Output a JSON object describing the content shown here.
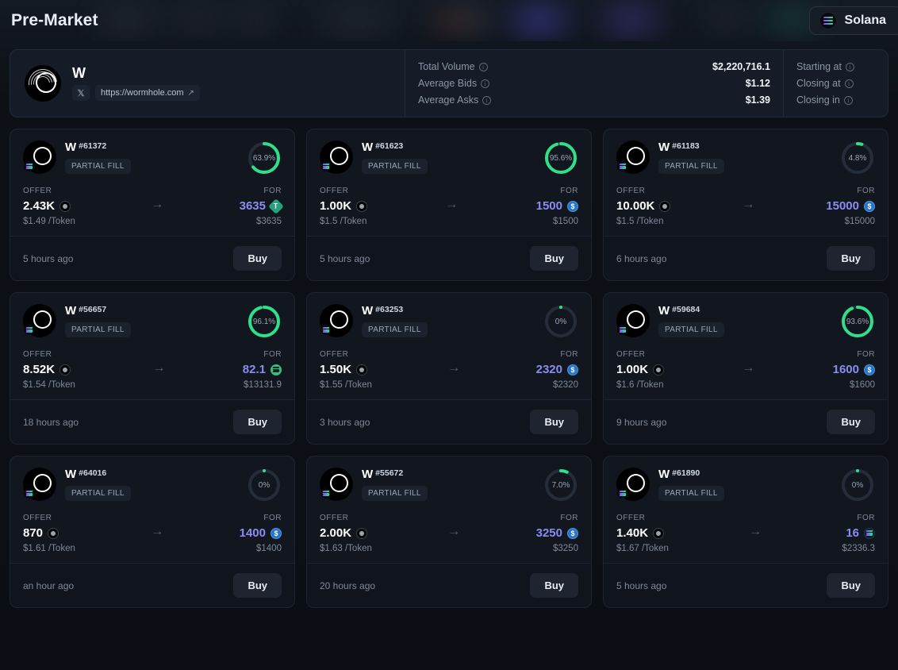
{
  "header": {
    "title": "Pre-Market",
    "chain_pill": {
      "label": "Solana",
      "icon": "solana-icon"
    }
  },
  "info_panel": {
    "token": {
      "symbol": "W",
      "logo_icon": "wormhole-logo-icon",
      "chain_badge_icon": "solana-badge-icon",
      "x_icon": "x-twitter-icon",
      "website_label": "https://wormhole.com",
      "external_link_icon": "external-link-icon"
    },
    "stats_left": [
      {
        "label": "Total Volume",
        "info_icon": "info-icon",
        "value": "$2,220,716.1"
      },
      {
        "label": "Average Bids",
        "info_icon": "info-icon",
        "value": "$1.12"
      },
      {
        "label": "Average Asks",
        "info_icon": "info-icon",
        "value": "$1.39"
      }
    ],
    "stats_right": [
      {
        "label": "Starting at",
        "info_icon": "info-icon",
        "value": ""
      },
      {
        "label": "Closing at",
        "info_icon": "info-icon",
        "value": ""
      },
      {
        "label": "Closing in",
        "info_icon": "info-icon",
        "value": ""
      }
    ]
  },
  "labels": {
    "offer": "OFFER",
    "for": "FOR",
    "fill_badge": "PARTIAL FILL",
    "buy": "Buy",
    "arrow_icon": "arrow-right-icon"
  },
  "colors": {
    "progress_ring": "#2fe08a",
    "ring_track": "#252d3a",
    "accent_amount": "#8b8cf0",
    "page_background": "#0d1117",
    "card_background": "#12171f"
  },
  "orders": [
    {
      "symbol": "W",
      "order_id": "#61372",
      "fill_status": "PARTIAL FILL",
      "progress_label": "63.9%",
      "progress_value": 63.9,
      "offer_amount": "2.43K",
      "offer_coin": "w-coin",
      "for_amount": "3635",
      "for_coin": "usdt-coin",
      "unit_price": "$1.49 /Token",
      "total_price": "$3635",
      "time_ago": "5 hours ago",
      "buy_label": "Buy"
    },
    {
      "symbol": "W",
      "order_id": "#61623",
      "fill_status": "PARTIAL FILL",
      "progress_label": "95.6%",
      "progress_value": 95.6,
      "offer_amount": "1.00K",
      "offer_coin": "w-coin",
      "for_amount": "1500",
      "for_coin": "usdc-coin",
      "unit_price": "$1.5 /Token",
      "total_price": "$1500",
      "time_ago": "5 hours ago",
      "buy_label": "Buy"
    },
    {
      "symbol": "W",
      "order_id": "#61183",
      "fill_status": "PARTIAL FILL",
      "progress_label": "4.8%",
      "progress_value": 4.8,
      "offer_amount": "10.00K",
      "offer_coin": "w-coin",
      "for_amount": "15000",
      "for_coin": "usdc-coin",
      "unit_price": "$1.5 /Token",
      "total_price": "$15000",
      "time_ago": "6 hours ago",
      "buy_label": "Buy"
    },
    {
      "symbol": "W",
      "order_id": "#56657",
      "fill_status": "PARTIAL FILL",
      "progress_label": "96.1%",
      "progress_value": 96.1,
      "offer_amount": "8.52K",
      "offer_coin": "w-coin",
      "for_amount": "82.1",
      "for_coin": "sol-green-coin",
      "unit_price": "$1.54 /Token",
      "total_price": "$13131.9",
      "time_ago": "18 hours ago",
      "buy_label": "Buy"
    },
    {
      "symbol": "W",
      "order_id": "#63253",
      "fill_status": "PARTIAL FILL",
      "progress_label": "0%",
      "progress_value": 0,
      "offer_amount": "1.50K",
      "offer_coin": "w-coin",
      "for_amount": "2320",
      "for_coin": "usdc-coin",
      "unit_price": "$1.55 /Token",
      "total_price": "$2320",
      "time_ago": "3 hours ago",
      "buy_label": "Buy"
    },
    {
      "symbol": "W",
      "order_id": "#59684",
      "fill_status": "PARTIAL FILL",
      "progress_label": "93.6%",
      "progress_value": 93.6,
      "offer_amount": "1.00K",
      "offer_coin": "w-coin",
      "for_amount": "1600",
      "for_coin": "usdc-coin",
      "unit_price": "$1.6 /Token",
      "total_price": "$1600",
      "time_ago": "9 hours ago",
      "buy_label": "Buy"
    },
    {
      "symbol": "W",
      "order_id": "#64016",
      "fill_status": "PARTIAL FILL",
      "progress_label": "0%",
      "progress_value": 0,
      "offer_amount": "870",
      "offer_coin": "w-coin",
      "for_amount": "1400",
      "for_coin": "usdc-coin",
      "unit_price": "$1.61 /Token",
      "total_price": "$1400",
      "time_ago": "an hour ago",
      "buy_label": "Buy"
    },
    {
      "symbol": "W",
      "order_id": "#55672",
      "fill_status": "PARTIAL FILL",
      "progress_label": "7.0%",
      "progress_value": 7.0,
      "offer_amount": "2.00K",
      "offer_coin": "w-coin",
      "for_amount": "3250",
      "for_coin": "usdc-coin",
      "unit_price": "$1.63 /Token",
      "total_price": "$3250",
      "time_ago": "20 hours ago",
      "buy_label": "Buy"
    },
    {
      "symbol": "W",
      "order_id": "#61890",
      "fill_status": "PARTIAL FILL",
      "progress_label": "0%",
      "progress_value": 0,
      "offer_amount": "1.40K",
      "offer_coin": "w-coin",
      "for_amount": "16",
      "for_coin": "sol-dark-coin",
      "unit_price": "$1.67 /Token",
      "total_price": "$2336.3",
      "time_ago": "5 hours ago",
      "buy_label": "Buy"
    }
  ]
}
